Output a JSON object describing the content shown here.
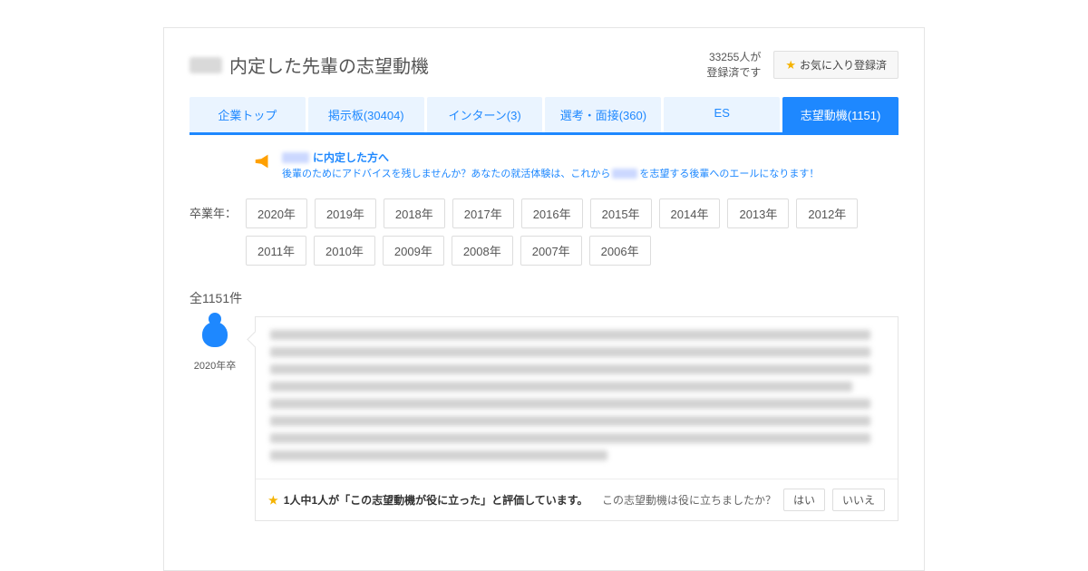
{
  "header": {
    "title": "内定した先輩の志望動機",
    "reg_line1": "33255人が",
    "reg_line2": "登録済です",
    "fav_button": "お気に入り登録済"
  },
  "tabs": [
    {
      "label": "企業トップ",
      "active": false
    },
    {
      "label": "掲示板(30404)",
      "active": false
    },
    {
      "label": "インターン(3)",
      "active": false
    },
    {
      "label": "選考・面接(360)",
      "active": false
    },
    {
      "label": "ES",
      "active": false
    },
    {
      "label": "志望動機(1151)",
      "active": true
    }
  ],
  "notice": {
    "title_suffix": "に内定した方へ",
    "body_prefix": "後輩のためにアドバイスを残しませんか？あなたの就活体験は、これから",
    "body_suffix": "を志望する後輩へのエールになります！"
  },
  "years": {
    "label": "卒業年：",
    "items": [
      "2020年",
      "2019年",
      "2018年",
      "2017年",
      "2016年",
      "2015年",
      "2014年",
      "2013年",
      "2012年",
      "2011年",
      "2010年",
      "2009年",
      "2008年",
      "2007年",
      "2006年"
    ]
  },
  "results": {
    "count_text": "全1151件",
    "entry_year": "2020年卒",
    "rating_text": "1人中1人が「この志望動機が役に立った」と評価しています。",
    "helpful_question": "この志望動機は役に立ちましたか？",
    "yes": "はい",
    "no": "いいえ"
  }
}
